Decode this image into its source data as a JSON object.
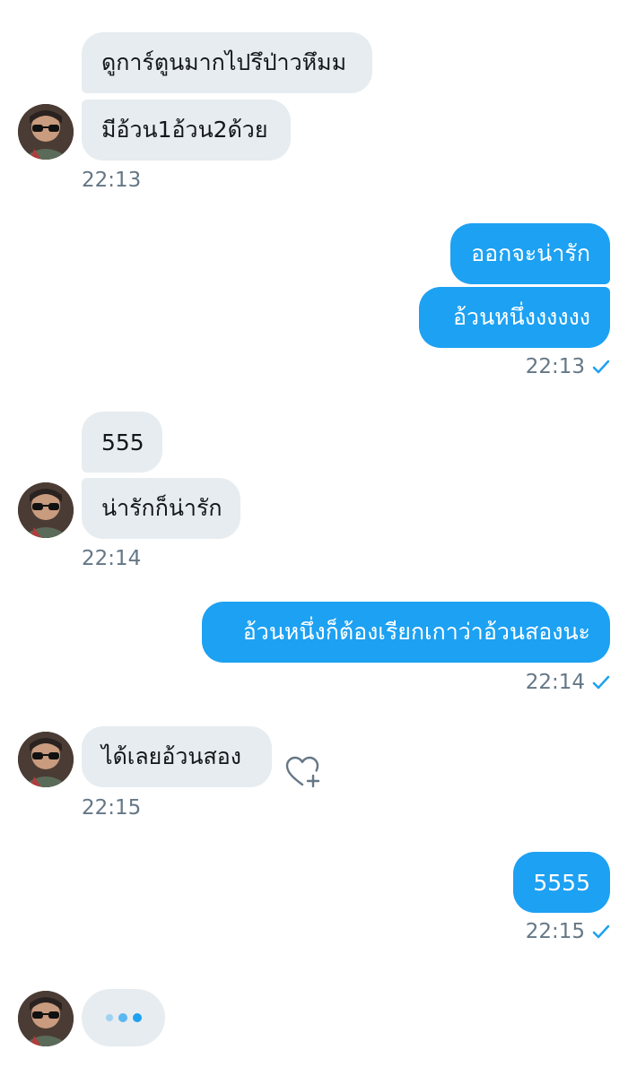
{
  "messages": [
    {
      "direction": "in",
      "text": "ดูการ์ตูนมากไปรึป่าวหึมม"
    },
    {
      "direction": "in",
      "text": "มีอ้วน1อ้วน2ด้วย"
    },
    {
      "direction": "out",
      "text": "ออกจะน่ารัก"
    },
    {
      "direction": "out",
      "text": "อ้วนหนึ่งงงงงง"
    },
    {
      "direction": "in",
      "text": "555"
    },
    {
      "direction": "in",
      "text": "น่ารักก็น่ารัก"
    },
    {
      "direction": "out",
      "text": "อ้วนหนึ่งก็ต้องเรียกเกาว่าอ้วนสองนะ"
    },
    {
      "direction": "in",
      "text": "ได้เลยอ้วนสอง"
    },
    {
      "direction": "out",
      "text": "5555"
    }
  ],
  "timestamps": [
    "22:13",
    "22:13",
    "22:14",
    "22:14",
    "22:15",
    "22:15"
  ],
  "icons": {
    "avatar": "avatar-image",
    "read_receipt": "checkmark-icon",
    "like": "heart-plus-icon",
    "typing": "typing-indicator"
  },
  "colors": {
    "outgoing_bubble": "#1da1f2",
    "incoming_bubble": "#e6ecf0",
    "timestamp": "#657786",
    "checkmark": "#1da1f2"
  }
}
